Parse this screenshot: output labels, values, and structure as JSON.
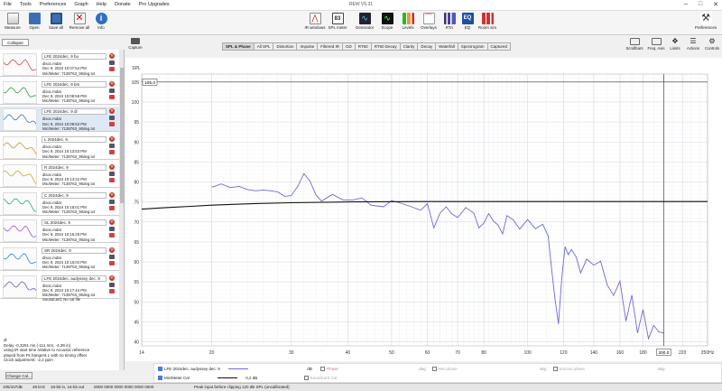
{
  "app": {
    "title": "REW V5.31"
  },
  "menu": [
    "File",
    "Tools",
    "Preferences",
    "Graph",
    "Help",
    "Donate",
    "Pro Upgrades"
  ],
  "toolbar_left": [
    {
      "label": "Measure",
      "icon": "measure-icon"
    },
    {
      "label": "Open",
      "icon": "folder-icon"
    },
    {
      "label": "Save all",
      "icon": "save-icon"
    },
    {
      "label": "Remove all",
      "icon": "remove-icon"
    },
    {
      "label": "Info",
      "icon": "info-icon"
    }
  ],
  "toolbar_center": [
    {
      "label": "IR windows",
      "icon": "ir-windows-icon"
    },
    {
      "label": "SPL meter",
      "icon": "spl-meter-icon",
      "readout": "83"
    },
    {
      "label": "Generator",
      "icon": "generator-icon"
    },
    {
      "label": "Scope",
      "icon": "scope-icon"
    },
    {
      "label": "Levels",
      "icon": "levels-icon"
    },
    {
      "label": "Overlays",
      "icon": "overlays-icon"
    },
    {
      "label": "RTA",
      "icon": "rta-icon"
    },
    {
      "label": "EQ",
      "icon": "eq-icon"
    },
    {
      "label": "Room sim",
      "icon": "room-sim-icon"
    }
  ],
  "toolbar_right": {
    "label": "Preferences",
    "icon": "preferences-icon"
  },
  "panel": {
    "collapse_label": "Collapse",
    "measurements": [
      {
        "name": "LFE 2024dec. 9 bu",
        "file": "disoc.mdat",
        "date": "Dec 9, 2024 10:07:54 PM",
        "mic": "Mic/Meter: 7138763_90deg.txt",
        "color": "#d24b4b"
      },
      {
        "name": "LFE 2024dec. 9 bm",
        "file": "disoc.mdat",
        "date": "Dec 9, 2024 10:08:58 PM",
        "mic": "Mic/Meter: 7138763_90deg.txt",
        "color": "#3a9a3a"
      },
      {
        "name": "LFE 2024dec. 9 dl",
        "file": "disoc.mdat",
        "date": "Dec 9, 2024 10:09:53 PM",
        "mic": "Mic/Meter: 7138763_90deg.txt",
        "color": "#3a7bd5"
      },
      {
        "name": "L 2024dec. 9",
        "file": "disoc.mdat",
        "date": "Dec 9, 2024 10:13:53 PM",
        "mic": "Mic/Meter: 7138763_90deg.txt",
        "color": "#d0902a"
      },
      {
        "name": "R 2024dec. 9",
        "file": "disoc.mdat",
        "date": "Dec 9, 2024 10:14:22 PM",
        "mic": "Mic/Meter: 7138763_90deg.txt",
        "color": "#c8b020"
      },
      {
        "name": "C 2024dec. 9",
        "file": "disoc.mdat",
        "date": "Dec 9, 2024 10:15:01 PM",
        "mic": "Mic/Meter: 7138763_90deg.txt",
        "color": "#2aa58a"
      },
      {
        "name": "SL 2024dec. 9",
        "file": "disoc.mdat",
        "date": "Dec 9, 2024 10:15:29 PM",
        "mic": "Mic/Meter: 7138763_90deg.txt",
        "color": "#9a5ad0"
      },
      {
        "name": "SR 2024dec. 9",
        "file": "disoc.mdat",
        "date": "Dec 9, 2024 10:16:04 PM",
        "mic": "Mic/Meter: 7138763_90deg.txt",
        "color": "#2a8ac8"
      },
      {
        "name": "LFE 2024dec. audyssey dec. 9",
        "file": "disoc.mdat",
        "date": "Dec 9, 2024 10:17:44 PM",
        "mic": "Mic/Meter: 7138763_90deg.txt",
        "extra": "Soundcard: No cal file",
        "color": "#6a5acd"
      }
    ],
    "note_lines": [
      "dl",
      "Delay -0,3251 ms (-111 mm, -4,39 in)",
      "using IR start time relative to Acoustic reference",
      "played from Fk hangerä L with no timing offset",
      "Clock adjustment: -2,2 ppm"
    ],
    "change_cal_label": "Change Cal..."
  },
  "graph": {
    "capture_label": "Capture",
    "tabs": [
      "SPL & Phase",
      "All SPL",
      "Distortion",
      "Impulse",
      "Filtered IR",
      "GD",
      "RT60",
      "RT60 Decay",
      "Clarity",
      "Decay",
      "Waterfall",
      "Spectrogram",
      "Captured"
    ],
    "active_tab": "SPL & Phase",
    "right_tools": [
      {
        "label": "Scrollbars",
        "icon": "scrollbars-icon"
      },
      {
        "label": "Freq. Axis",
        "icon": "freq-axis-icon"
      },
      {
        "label": "Limits",
        "icon": "limits-icon"
      },
      {
        "label": "Actions",
        "icon": "actions-icon"
      },
      {
        "label": "Controls",
        "icon": "controls-icon"
      }
    ]
  },
  "chart_data": {
    "type": "line",
    "xscale": "log",
    "xlim": [
      14,
      250
    ],
    "ylim": [
      39,
      107
    ],
    "ylabel": "SPL",
    "y_ticks": [
      40,
      45,
      50,
      55,
      60,
      65,
      70,
      75,
      80,
      85,
      90,
      95,
      100,
      105
    ],
    "x_ticks": [
      {
        "v": 14,
        "label": "14"
      },
      {
        "v": 20,
        "label": "20"
      },
      {
        "v": 30,
        "label": "30"
      },
      {
        "v": 40,
        "label": "40"
      },
      {
        "v": 50,
        "label": "50"
      },
      {
        "v": 60,
        "label": "60"
      },
      {
        "v": 70,
        "label": "70"
      },
      {
        "v": 80,
        "label": "80"
      },
      {
        "v": 100,
        "label": "100"
      },
      {
        "v": 120,
        "label": "120"
      },
      {
        "v": 140,
        "label": "140"
      },
      {
        "v": 160,
        "label": "160"
      },
      {
        "v": 180,
        "label": "180"
      },
      {
        "v": 200,
        "label": "200"
      },
      {
        "v": 220,
        "label": "220"
      },
      {
        "v": 250,
        "label": "250Hz"
      }
    ],
    "cursor": {
      "x": 200,
      "y": 105,
      "x_label": "200.0",
      "y_label": "105.0"
    },
    "series": [
      {
        "name": "LFE 2024dec. audyssey dec. 9",
        "color": "#6a6ad8",
        "x": [
          20,
          21,
          22,
          23,
          24,
          25,
          26,
          27,
          28,
          29,
          30,
          31,
          32,
          33,
          34,
          35,
          37,
          39,
          41,
          43,
          45,
          48,
          50,
          52,
          55,
          58,
          60,
          62,
          64,
          66,
          68,
          70,
          73,
          76,
          78,
          80,
          82,
          84,
          86,
          88,
          90,
          93,
          96,
          100,
          104,
          108,
          111,
          113,
          115,
          117,
          119,
          121,
          123,
          125,
          128,
          131,
          135,
          140,
          145,
          150,
          155,
          160,
          165,
          170,
          175,
          180,
          185,
          190,
          195,
          200
        ],
        "y": [
          78.7,
          79.5,
          78.6,
          78.9,
          78.1,
          77.8,
          78.0,
          77.8,
          77.5,
          76.4,
          76.6,
          78.9,
          82.1,
          80.2,
          76.8,
          75.2,
          76.9,
          75.5,
          75.5,
          76.0,
          74.2,
          73.8,
          75.3,
          74.8,
          73.9,
          72.9,
          74.6,
          68.5,
          72.2,
          73.8,
          72.0,
          71.1,
          73.6,
          72.2,
          68.5,
          69.7,
          72.1,
          70.2,
          69.2,
          67.0,
          71.6,
          70.5,
          68.2,
          70.6,
          68.3,
          69.4,
          66.5,
          58.0,
          50.5,
          44.5,
          56.0,
          63.8,
          61.8,
          63.1,
          61.2,
          57.2,
          60.7,
          59.2,
          60.2,
          54.2,
          51.6,
          55.2,
          45.2,
          51.7,
          42.2,
          48.1,
          40.8,
          44.1,
          42.5,
          42.2
        ]
      },
      {
        "name": "Mic/Meter Cal",
        "color": "#111111",
        "x": [
          14,
          16,
          18,
          20,
          25,
          30,
          40,
          60,
          100,
          150,
          200,
          250
        ],
        "y": [
          73.2,
          73.6,
          73.9,
          74.2,
          74.6,
          74.8,
          75.0,
          75.1,
          75.1,
          75.1,
          75.1,
          75.1
        ]
      }
    ]
  },
  "legend": {
    "rows": [
      {
        "name": "LFE 2024dec. audyssey dec. 9",
        "unit": "dB",
        "phase_label": "Phase",
        "phase_unit": "deg",
        "minphase_label": "Min phase",
        "minphase_unit": "deg",
        "excess_label": "Excess phase",
        "excess_unit": "deg"
      },
      {
        "name": "Mic/Meter Cal",
        "value": "0,2 dB",
        "soundcard_label": "Soundcard Cal"
      }
    ]
  },
  "status": {
    "level": "105/107dB",
    "rate": "48 kHz",
    "bits": "16-bit in, 16-bit out",
    "scope": "0000 0000  0000 0000  0000 0000",
    "message": "Peak input before clipping 120 dB SPL (uncalibrated)"
  }
}
